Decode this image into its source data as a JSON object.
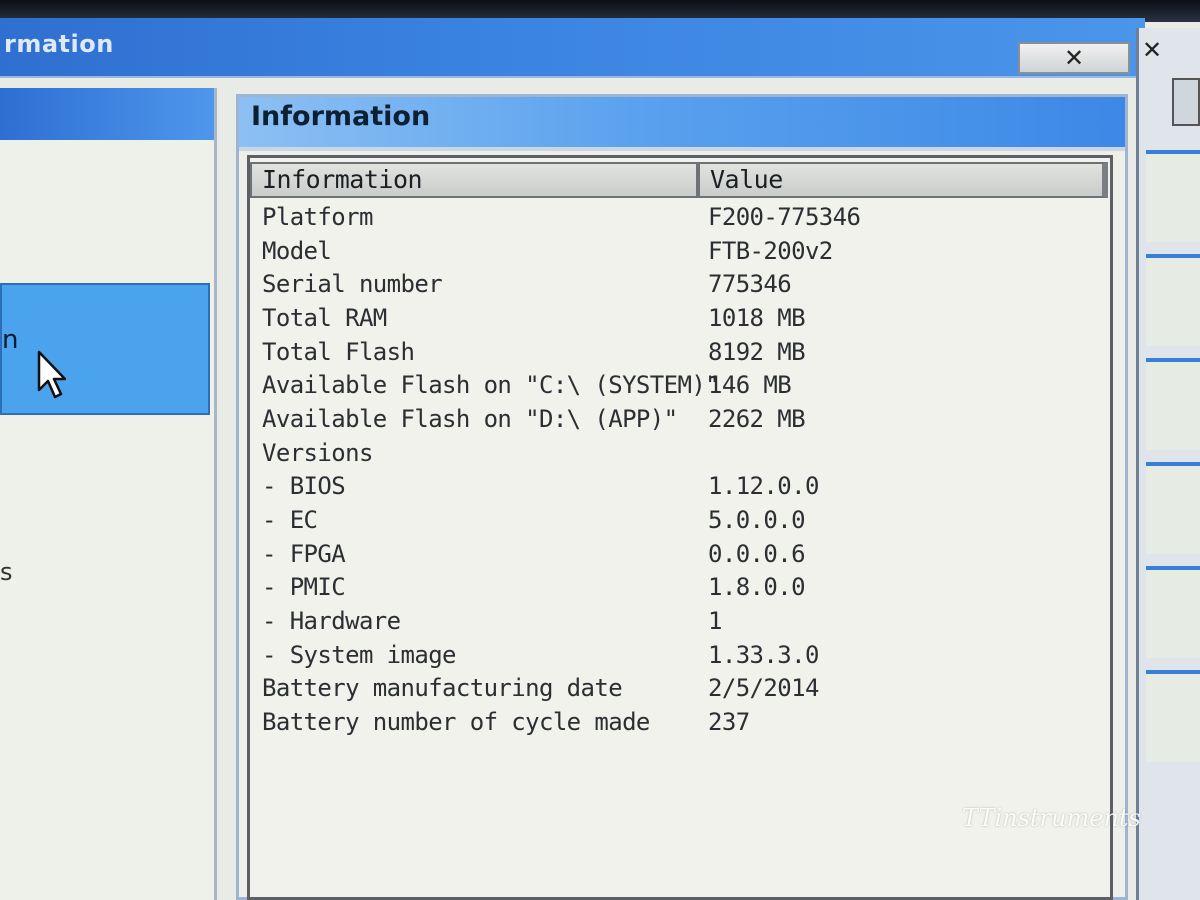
{
  "outer_window": {
    "title_fragment": "rmation",
    "close_glyph": "✕"
  },
  "left_panel": {
    "selected_text_fragment": "n",
    "lower_text_fragment": "s"
  },
  "main_window": {
    "title": "Information"
  },
  "table": {
    "columns": [
      "Information",
      "Value"
    ],
    "rows": [
      {
        "name": "Platform",
        "value": "F200-775346"
      },
      {
        "name": "Model",
        "value": "FTB-200v2"
      },
      {
        "name": "Serial number",
        "value": "775346"
      },
      {
        "name": "Total RAM",
        "value": "1018 MB"
      },
      {
        "name": "Total Flash",
        "value": "8192 MB"
      },
      {
        "name": "Available Flash on \"C:\\ (SYSTEM)\"",
        "value": "146 MB"
      },
      {
        "name": "Available Flash on \"D:\\ (APP)\"",
        "value": "2262 MB"
      },
      {
        "name": "Versions",
        "value": ""
      },
      {
        "name": "- BIOS",
        "value": "1.12.0.0"
      },
      {
        "name": "- EC",
        "value": "5.0.0.0"
      },
      {
        "name": "- FPGA",
        "value": "0.0.0.6"
      },
      {
        "name": "- PMIC",
        "value": "1.8.0.0"
      },
      {
        "name": "- Hardware",
        "value": "1"
      },
      {
        "name": "- System image",
        "value": "1.33.3.0"
      },
      {
        "name": "Battery manufacturing date",
        "value": "2/5/2014"
      },
      {
        "name": "Battery number of cycle made",
        "value": "237"
      }
    ]
  },
  "watermark": "TTinstruments",
  "colors": {
    "titlebar_blue": "#3a82e0",
    "selection_blue": "#4aa3ec",
    "panel_bg": "#edefe8"
  }
}
